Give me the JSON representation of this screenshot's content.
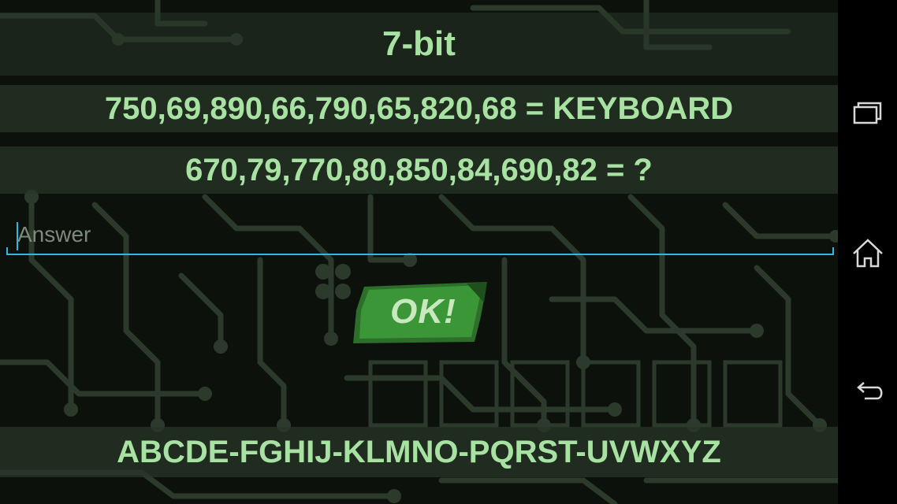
{
  "puzzle": {
    "title": "7-bit",
    "clue": "750,69,890,66,790,65,820,68 = KEYBOARD",
    "question": "670,79,770,80,850,84,690,82 = ?",
    "answer_placeholder": "Answer",
    "answer_value": "",
    "ok_label": "OK!",
    "alphabet": "ABCDE-FGHIJ-KLMNO-PQRST-UVWXYZ"
  },
  "nav": {
    "recents_icon": "recent-apps-icon",
    "home_icon": "home-icon",
    "back_icon": "back-icon"
  },
  "colors": {
    "text_green": "#a8e2a2",
    "band": "#283428",
    "accent": "#33b5e5",
    "button_green": "#2e8a2e"
  }
}
